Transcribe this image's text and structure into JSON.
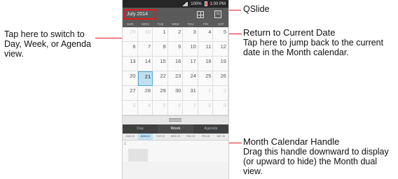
{
  "callouts": {
    "switch_view": "Tap here to switch to Day, Week, or Agenda view.",
    "qslide": "QSlide",
    "return_title": "Return to Current Date",
    "return_desc": "Tap here to jump back to the current date in the Month calendar.",
    "handle_title": "Month Calendar Handle",
    "handle_desc": "Drag this handle downward to display (or upward to hide) the Month dual view."
  },
  "colors": {
    "callout_line": "#e31b1b",
    "today_highlight": "#bfe0f0",
    "topbar": "#5a5a5a"
  },
  "phone": {
    "status": {
      "battery": "100%",
      "time": "1:00 PM"
    },
    "header": {
      "month_label": "July 2014",
      "today_icon_text": "31"
    },
    "weekdays": [
      "SUN",
      "MON",
      "TUE",
      "WED",
      "THU",
      "FRI",
      "SAT"
    ],
    "weeks": [
      [
        "29",
        "30",
        "1",
        "2",
        "3",
        "4",
        "5"
      ],
      [
        "6",
        "7",
        "8",
        "9",
        "10",
        "11",
        "12"
      ],
      [
        "13",
        "14",
        "15",
        "16",
        "17",
        "18",
        "19"
      ],
      [
        "20",
        "21",
        "22",
        "23",
        "24",
        "25",
        "26"
      ],
      [
        "27",
        "28",
        "29",
        "30",
        "31",
        "1",
        "2"
      ],
      [
        "3",
        "4",
        "5",
        "6",
        "7",
        "8",
        "9"
      ]
    ],
    "view_tabs": [
      "Day",
      "Week",
      "Agenda"
    ],
    "week_strip": [
      "SUN 20",
      "MON 21",
      "TUE 22",
      "WED 23",
      "THU 24",
      "FRI 25",
      "SAT 26"
    ],
    "agenda_hour": "1"
  }
}
